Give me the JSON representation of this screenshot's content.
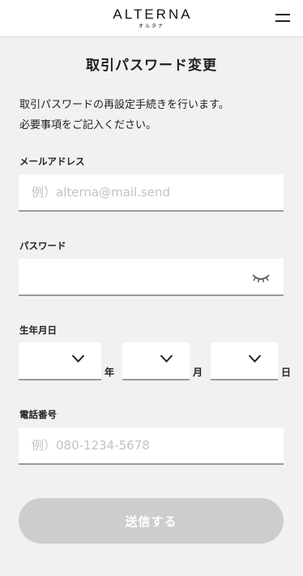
{
  "header": {
    "logo_text": "ALTERNA",
    "logo_sub": "オルタナ",
    "menu_icon": "hamburger-menu-icon"
  },
  "page": {
    "title": "取引パスワード変更",
    "description_line1": "取引パスワードの再設定手続きを行います。",
    "description_line2": "必要事項をご記入ください。"
  },
  "form": {
    "email": {
      "label": "メールアドレス",
      "placeholder": "例）alterna@mail.send",
      "value": ""
    },
    "password": {
      "label": "パスワード",
      "value": "",
      "toggle_icon": "closed-eye-icon"
    },
    "birthdate": {
      "label": "生年月日",
      "year_unit": "年",
      "month_unit": "月",
      "day_unit": "日",
      "year_value": "",
      "month_value": "",
      "day_value": "",
      "dropdown_icon": "chevron-down-icon"
    },
    "phone": {
      "label": "電話番号",
      "placeholder": "例）080-1234-5678",
      "value": ""
    },
    "submit_label": "送信する"
  },
  "colors": {
    "background": "#f1f1f1",
    "field_background": "#ffffff",
    "field_underline": "#9a9a9a",
    "placeholder": "#c2c2c2",
    "submit_disabled": "#cdcdcd"
  }
}
